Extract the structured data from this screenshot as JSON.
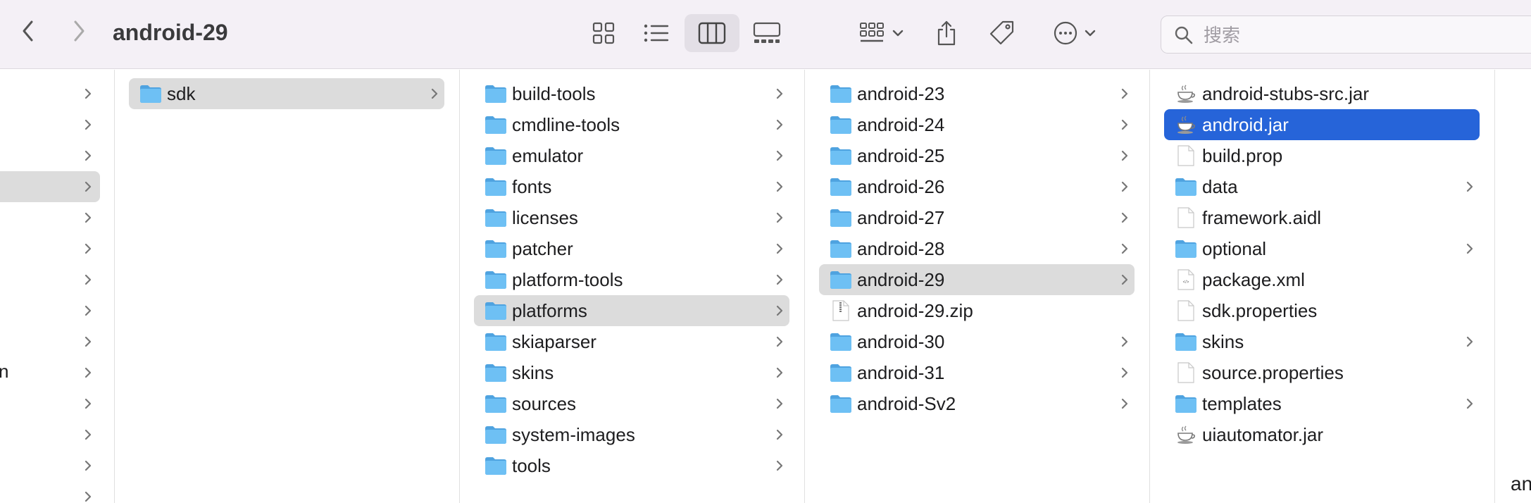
{
  "window": {
    "title": "android-29"
  },
  "toolbar": {
    "view_icons": [
      "grid-view-icon",
      "list-view-icon",
      "column-view-icon",
      "gallery-view-icon"
    ],
    "active_view": "column-view-icon"
  },
  "search": {
    "placeholder": "搜索",
    "value": ""
  },
  "column0": {
    "partial_text": "n"
  },
  "column1": {
    "items": [
      {
        "label": "sdk",
        "type": "folder"
      }
    ]
  },
  "column2": {
    "items": [
      {
        "label": "build-tools",
        "type": "folder"
      },
      {
        "label": "cmdline-tools",
        "type": "folder"
      },
      {
        "label": "emulator",
        "type": "folder"
      },
      {
        "label": "fonts",
        "type": "folder"
      },
      {
        "label": "licenses",
        "type": "folder"
      },
      {
        "label": "patcher",
        "type": "folder"
      },
      {
        "label": "platform-tools",
        "type": "folder"
      },
      {
        "label": "platforms",
        "type": "folder"
      },
      {
        "label": "skiaparser",
        "type": "folder"
      },
      {
        "label": "skins",
        "type": "folder"
      },
      {
        "label": "sources",
        "type": "folder"
      },
      {
        "label": "system-images",
        "type": "folder"
      },
      {
        "label": "tools",
        "type": "folder"
      }
    ]
  },
  "column3": {
    "items": [
      {
        "label": "android-23",
        "type": "folder"
      },
      {
        "label": "android-24",
        "type": "folder"
      },
      {
        "label": "android-25",
        "type": "folder"
      },
      {
        "label": "android-26",
        "type": "folder"
      },
      {
        "label": "android-27",
        "type": "folder"
      },
      {
        "label": "android-28",
        "type": "folder"
      },
      {
        "label": "android-29",
        "type": "folder"
      },
      {
        "label": "android-29.zip",
        "type": "zip"
      },
      {
        "label": "android-30",
        "type": "folder"
      },
      {
        "label": "android-31",
        "type": "folder"
      },
      {
        "label": "android-Sv2",
        "type": "folder"
      }
    ]
  },
  "column4": {
    "items": [
      {
        "label": "android-stubs-src.jar",
        "type": "jar"
      },
      {
        "label": "android.jar",
        "type": "jar"
      },
      {
        "label": "build.prop",
        "type": "file"
      },
      {
        "label": "data",
        "type": "folder"
      },
      {
        "label": "framework.aidl",
        "type": "file"
      },
      {
        "label": "optional",
        "type": "folder"
      },
      {
        "label": "package.xml",
        "type": "xml"
      },
      {
        "label": "sdk.properties",
        "type": "file"
      },
      {
        "label": "skins",
        "type": "folder"
      },
      {
        "label": "source.properties",
        "type": "file"
      },
      {
        "label": "templates",
        "type": "folder"
      },
      {
        "label": "uiautomator.jar",
        "type": "jar"
      }
    ]
  },
  "column5": {
    "partial_text": "an"
  },
  "colors": {
    "selection_blue": "#2664d9",
    "selection_grey": "#dcdcdc",
    "folder_blue": "#5eb4f0"
  }
}
